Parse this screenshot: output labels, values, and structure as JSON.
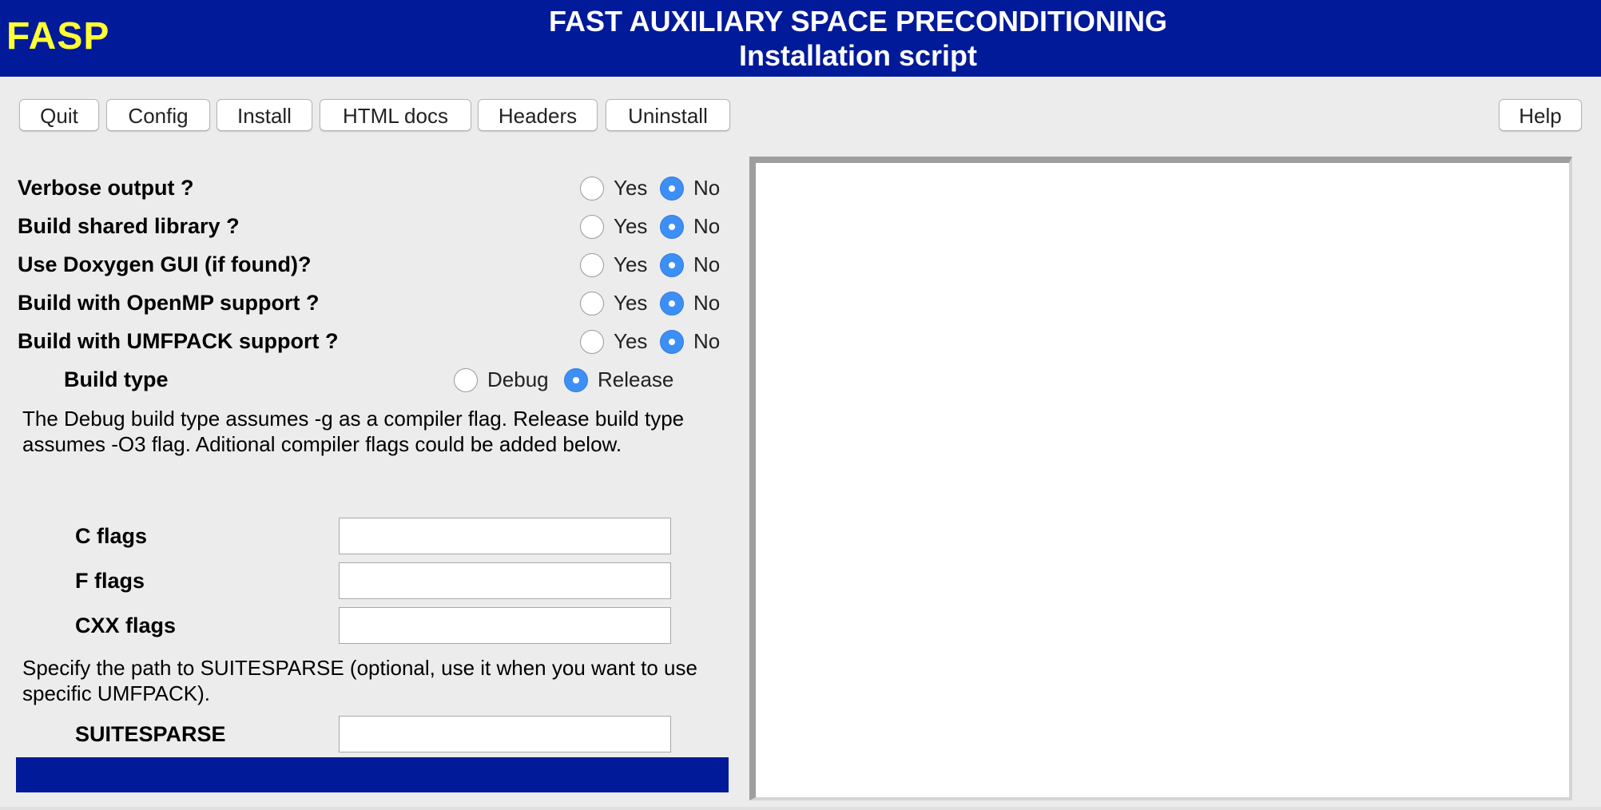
{
  "header": {
    "logo": "FASP",
    "title_line1": "FAST AUXILIARY SPACE PRECONDITIONING",
    "title_line2": "Installation script",
    "background_color": "#001a99",
    "logo_color": "#ffff33"
  },
  "toolbar": {
    "quit": "Quit",
    "config": "Config",
    "install": "Install",
    "html_docs": "HTML docs",
    "headers": "Headers",
    "uninstall": "Uninstall",
    "help": "Help"
  },
  "options": [
    {
      "label": "Verbose output ?",
      "yes": "Yes",
      "no": "No",
      "selected": "No"
    },
    {
      "label": "Build shared library ?",
      "yes": "Yes",
      "no": "No",
      "selected": "No"
    },
    {
      "label": "Use Doxygen GUI (if found)?",
      "yes": "Yes",
      "no": "No",
      "selected": "No"
    },
    {
      "label": "Build with OpenMP support ?",
      "yes": "Yes",
      "no": "No",
      "selected": "No"
    },
    {
      "label": "Build with UMFPACK support ?",
      "yes": "Yes",
      "no": "No",
      "selected": "No"
    }
  ],
  "build_type": {
    "label": "Build type",
    "debug": "Debug",
    "release": "Release",
    "selected": "Release"
  },
  "build_note": "The Debug build type assumes -g as a compiler flag. Release build type assumes -O3 flag. Aditional compiler flags could be added below.",
  "flags": {
    "c_flags": {
      "label": "C flags",
      "value": ""
    },
    "f_flags": {
      "label": "F flags",
      "value": ""
    },
    "cxx_flags": {
      "label": "CXX flags",
      "value": ""
    }
  },
  "suitesparse_note": "Specify the path to SUITESPARSE (optional, use it when you want to use specific UMFPACK).",
  "suitesparse": {
    "label": "SUITESPARSE",
    "value": ""
  },
  "colors": {
    "radio_selected": "#3d8ff5",
    "status_bar": "#001a99"
  }
}
